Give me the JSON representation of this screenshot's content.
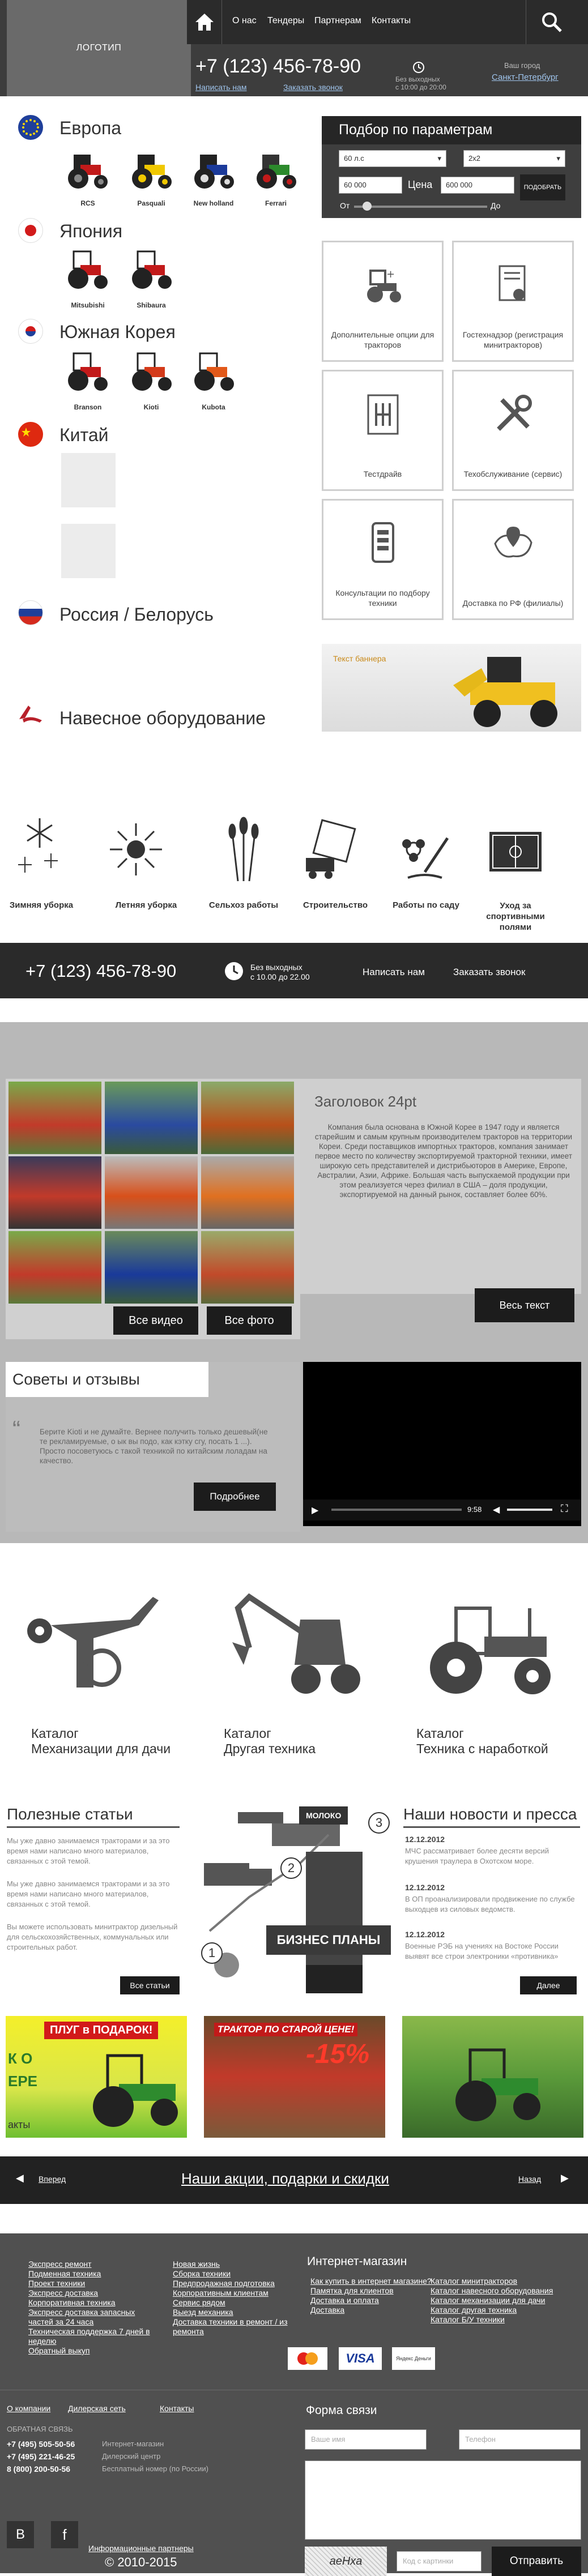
{
  "header": {
    "logo": "ЛОГОТИП",
    "nav": [
      "О нас",
      "Тендеры",
      "Партнерам",
      "Контакты"
    ],
    "phone": "+7 (123) 456-78-90",
    "write_us": "Написать нам",
    "order_call": "Заказать звонок",
    "hours_l1": "Без выходных",
    "hours_l2": "с 10:00 до 20:00",
    "city_label": "Ваш город",
    "city": "Санкт-Петербург"
  },
  "regions": {
    "europe": {
      "title": "Европа",
      "brands": [
        "RCS",
        "Pasquali",
        "New holland",
        "Ferrari"
      ]
    },
    "japan": {
      "title": "Япония",
      "brands": [
        "Mitsubishi",
        "Shibaura"
      ]
    },
    "korea": {
      "title": "Южная Корея",
      "brands": [
        "Branson",
        "Kioti",
        "Kubota"
      ]
    },
    "china": {
      "title": "Китай"
    },
    "russia": {
      "title": "Россия / Белорусь"
    },
    "attach": {
      "title": "Навесное оборудование"
    }
  },
  "filter": {
    "title": "Подбор по параметрам",
    "select1": "60 л.с",
    "select2": "2x2",
    "price_from": "60 000",
    "price_label": "Цена",
    "price_to": "600 000",
    "from_label": "От",
    "to_label": "До",
    "button": "ПОДОБРАТЬ"
  },
  "tiles": [
    {
      "label": "Дополнительные опции для тракторов",
      "icon": "tractor-options-icon"
    },
    {
      "label": "Гостехнадзор (регистрация минитракторов)",
      "icon": "certificate-icon"
    },
    {
      "label": "Тестдрайв",
      "icon": "gearbox-icon"
    },
    {
      "label": "Техобслуживание (сервис)",
      "icon": "tools-icon"
    },
    {
      "label": "Консультации по подбору техники",
      "icon": "phone-consult-icon"
    },
    {
      "label": "Доставка по РФ (филиалы)",
      "icon": "map-pin-icon"
    }
  ],
  "banner": {
    "text": "Текст баннера"
  },
  "seasons": [
    "Зимняя уборка",
    "Летняя уборка",
    "Сельхоз работы",
    "Строительство",
    "Работы по саду",
    "Уход за спортивными полями"
  ],
  "phone_bar": {
    "phone": "+7 (123) 456-78-90",
    "hours_l1": "Без выходных",
    "hours_l2": "с 10.00 до 22.00",
    "write_us": "Написать нам",
    "order_call": "Заказать звонок"
  },
  "gallery": {
    "all_video": "Все видео",
    "all_photo": "Все фото",
    "heading": "Заголовок 24pt",
    "text": "Компания была основана в Южной Корее в 1947 году и является старейшим и самым крупным производителем тракторов на территории Кореи. Среди поставщиков импортных тракторов, компания занимает первое место по количеству экспортируемой тракторной техники, имеет широкую сеть представителей и дистрибьюторов в Америке, Европе, Австралии, Азии, Африке. Большая часть выпускаемой продукции при этом реализуется через филиал в США – доля продукции, экспортируемой на данный рынок, составляет более 60%.",
    "all_text": "Весь текст",
    "reviews_title": "Советы и отзывы",
    "review_text": "Берите Kioti и не думайте. Вернее получить только дешевый(не те рекламируемые, о ык вы подо, как кэтку сгу, посать 1 ...). Просто посоветуюсь с такой техникой по китайским лоладам на качество.",
    "more": "Подробнее",
    "video_time": "9:58"
  },
  "catalog": [
    {
      "l1": "Каталог",
      "l2": "Механизации для дачи"
    },
    {
      "l1": "Каталог",
      "l2": "Другая техника"
    },
    {
      "l1": "Каталог",
      "l2": "Техника с наработкой"
    }
  ],
  "articles": {
    "title": "Полезные статьи",
    "items": [
      "Мы уже давно занимаемся тракторами и за это время нами написано много материалов, связанных с этой темой.",
      "Мы уже давно занимаемся тракторами и за это время нами написано много материалов, связанных с этой темой.",
      "Вы можете использовать минитрактор дизельный для сельскохозяйственных, коммунальных или строительных работ."
    ],
    "all_link": "Все статьи"
  },
  "business": {
    "milk": "МОЛОКО",
    "steps": [
      "1",
      "2",
      "3"
    ],
    "title": "БИЗНЕС ПЛАНЫ"
  },
  "news": {
    "title": "Наши новости и пресса",
    "items": [
      {
        "date": "12.12.2012",
        "text": "МЧС рассматривает более десяти версий крушения траулера в Охотском море."
      },
      {
        "date": "12.12.2012",
        "text": "В ОП проанализировали продвижение по службе выходцев из силовых ведомств."
      },
      {
        "date": "12.12.2012",
        "text": "Военные РЭБ на учениях на Востоке России выявят все строи электроники «противника»"
      }
    ],
    "more": "Далее"
  },
  "promos": {
    "p1_title": "ПЛУГ в ПОДАРОК!",
    "p1_side_top": "К О",
    "p1_side_mid": "ЕРЕ",
    "p1_side_bot": "акты",
    "p2_title": "ТРАКТОР ПО СТАРОЙ ЦЕНЕ!",
    "p2_discount": "-15%"
  },
  "promo_bar": {
    "prev": "Вперед",
    "title": "Наши акции, подарки и скидки",
    "next": "Назад"
  },
  "footer": {
    "col1": [
      "Экспресс ремонт",
      "Подменная техника",
      "Проект техники",
      "Экспресс доставка",
      "Корпоративная техника",
      "Экспресс доставка запасных частей за 24 часа",
      "Техническая поддержка 7 дней в неделю",
      "Обратный выкуп"
    ],
    "col2": [
      "Новая жизнь",
      "Сборка техники",
      "Предпродажная подготовка",
      "Корпоративным клиентам",
      "Сервис рядом",
      "Выезд механика",
      "Доставка техники в ремонт / из ремонта"
    ],
    "shop_title": "Интернет-магазин",
    "shop1": [
      "Как купить в интернет магазине?",
      "Памятка для клиентов",
      "Доставка и оплата",
      "Доставка"
    ],
    "shop2": [
      "Каталог минитракторов",
      "Каталог навесного оборудования",
      "Каталог механизации для дачи",
      "Каталог другая техника",
      "Каталог Б/У техники"
    ],
    "pay": [
      "MasterCard",
      "VISA",
      "Яндекс Деньги"
    ],
    "bottom_links": [
      "О компании",
      "Дилерская сеть",
      "Контакты"
    ],
    "feedback_label": "ОБРАТНАЯ СВЯЗЬ",
    "contacts": [
      {
        "phone": "+7 (495) 505-50-56",
        "note": "Интернет-магазин"
      },
      {
        "phone": "+7 (495) 221-46-25",
        "note": "Дилерский центр"
      },
      {
        "phone": "8 (800) 200-50-56",
        "note": "Бесплатный номер (по России)"
      }
    ],
    "social": [
      "B",
      "f"
    ],
    "partners": "Информационные партнеры",
    "form_title": "Форма связи",
    "name_ph": "Ваше имя",
    "phone_ph": "Телефон",
    "captcha": "aeHxa",
    "code_ph": "Код с картинки",
    "send": "Отправить",
    "copyright": "© 2010-2015"
  }
}
